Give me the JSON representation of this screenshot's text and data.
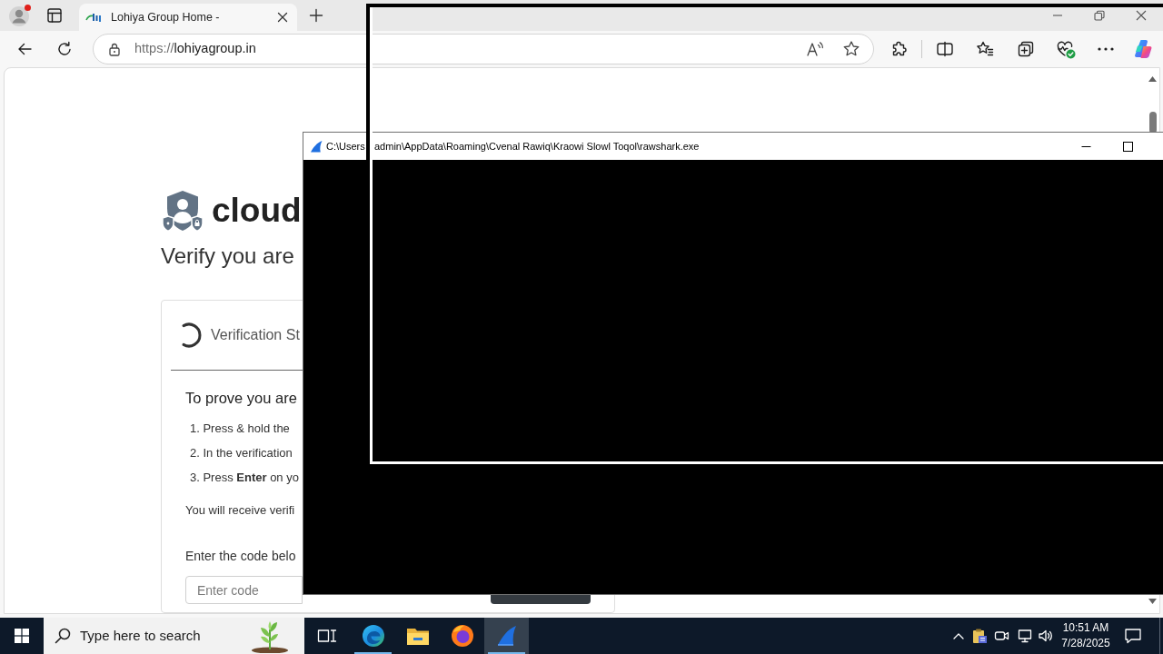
{
  "browser": {
    "tabs": [
      {
        "title": "Lohiya Group Home -",
        "selected": true
      }
    ],
    "address_bar": {
      "scheme": "https://",
      "host": "lohiyagroup.in"
    }
  },
  "page": {
    "brand": "cloud",
    "heading": "Verify you are",
    "card": {
      "title": "Verification St",
      "prompt": "To prove you are",
      "steps": [
        "1. Press & hold the",
        "2. In the verification",
        "3. Press **Enter** on yo"
      ],
      "note": "You will receive verifi",
      "code_label": "Enter the code belo",
      "code_field": {
        "placeholder": "Enter code"
      }
    }
  },
  "console_window": {
    "title_segments": [
      "C:\\Users",
      "admin\\AppData\\Roaming\\Cvenal Rawiq\\Kraowi Slowl Toqol\\rawshark.exe"
    ]
  },
  "taskbar": {
    "search": {
      "placeholder": "Type here to search"
    },
    "apps": [
      {
        "kind": "edge",
        "running": true,
        "selected": false
      },
      {
        "kind": "explorer",
        "running": false,
        "selected": false
      },
      {
        "kind": "firefox",
        "running": false,
        "selected": false
      },
      {
        "kind": "shark",
        "running": true,
        "selected": true
      }
    ],
    "clock": {
      "time": "10:51 AM",
      "date": "7/28/2025"
    }
  }
}
